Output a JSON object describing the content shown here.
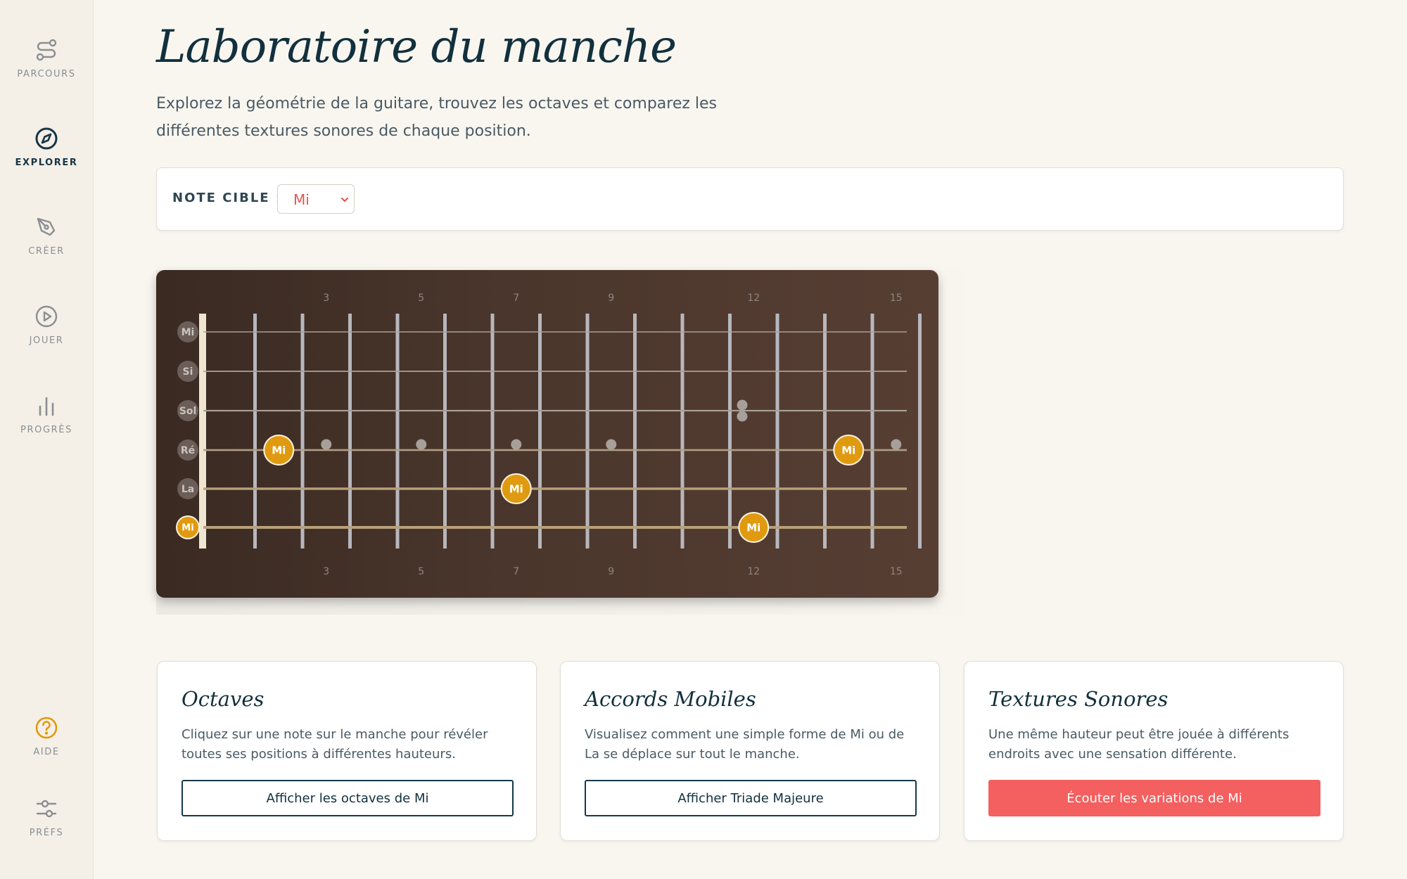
{
  "sidebar": {
    "items": [
      {
        "label": "PARCOURS",
        "icon": "route-icon"
      },
      {
        "label": "EXPLORER",
        "icon": "compass-icon",
        "active": true
      },
      {
        "label": "CRÉER",
        "icon": "pen-icon"
      },
      {
        "label": "JOUER",
        "icon": "play-icon"
      },
      {
        "label": "PROGRÈS",
        "icon": "bar-chart-icon"
      }
    ],
    "bottom_items": [
      {
        "label": "AIDE",
        "icon": "help-icon"
      },
      {
        "label": "PRÉFS",
        "icon": "sliders-icon"
      }
    ]
  },
  "header": {
    "title": "Laboratoire du manche",
    "subtitle": "Explorez la géométrie de la guitare, trouvez les octaves et comparez les différentes textures sonores de chaque position."
  },
  "note_picker": {
    "label": "NOTE CIBLE :",
    "selected": "Mi"
  },
  "fretboard": {
    "string_names": [
      "Mi",
      "Si",
      "Sol",
      "Ré",
      "La",
      "Mi"
    ],
    "fret_markers": [
      "3",
      "5",
      "7",
      "9",
      "12",
      "15"
    ],
    "highlighted_notes": [
      {
        "string": 6,
        "fret": 0,
        "label": "Mi"
      },
      {
        "string": 4,
        "fret": 2,
        "label": "Mi"
      },
      {
        "string": 5,
        "fret": 7,
        "label": "Mi"
      },
      {
        "string": 6,
        "fret": 12,
        "label": "Mi"
      },
      {
        "string": 4,
        "fret": 14,
        "label": "Mi"
      }
    ],
    "colors": {
      "highlight": "#e09a0f",
      "wood": "#4a362c"
    }
  },
  "cards": [
    {
      "title": "Octaves",
      "text": "Cliquez sur une note sur le manche pour révéler toutes ses positions à différentes hauteurs.",
      "button": "Afficher les octaves de Mi"
    },
    {
      "title": "Accords Mobiles",
      "text": "Visualisez comment une simple forme de Mi ou de La se déplace sur tout le manche.",
      "button": "Afficher Triade Majeure"
    },
    {
      "title": "Textures Sonores",
      "text": "Une même hauteur peut être jouée à différents endroits avec une sensation différente.",
      "button": "Écouter les variations de Mi"
    }
  ],
  "colors": {
    "accent": "#f45f5f",
    "brand": "#12303d",
    "gold": "#e09a0f"
  }
}
